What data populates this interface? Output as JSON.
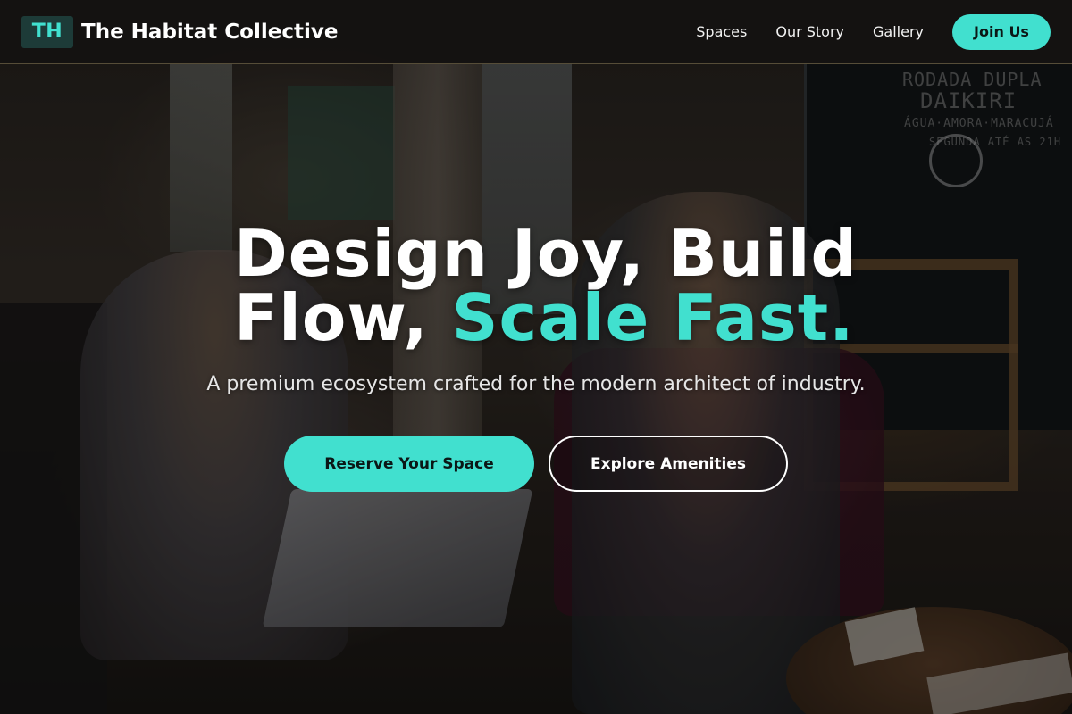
{
  "brand": {
    "mark": "TH",
    "name": "The Habitat Collective"
  },
  "nav": {
    "links": [
      "Spaces",
      "Our Story",
      "Gallery"
    ],
    "cta": "Join Us"
  },
  "hero": {
    "headline_line1": "Design Joy, Build",
    "headline_line2_prefix": "Flow, ",
    "headline_accent": "Scale Fast.",
    "subheadline": "A premium ecosystem crafted for the modern architect of industry.",
    "primary_cta": "Reserve Your Space",
    "secondary_cta": "Explore Amenities"
  },
  "background_chalkboard": {
    "lines": [
      "RODADA DUPLA",
      "DAIKIRI",
      "ÁGUA·AMORA·MARACUJÁ",
      "SEGUNDA  ATÉ AS 21H"
    ]
  },
  "colors": {
    "accent": "#41e0cf",
    "nav_background": "#141211",
    "text": "#ffffff"
  }
}
